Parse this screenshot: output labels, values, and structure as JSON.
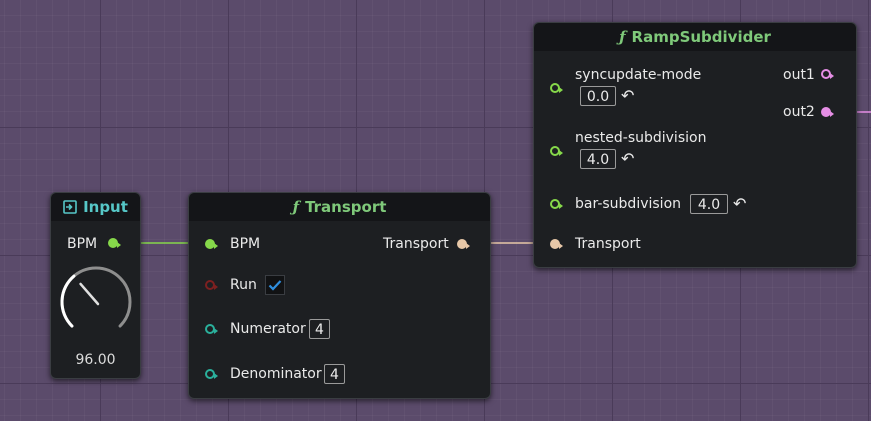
{
  "colors": {
    "background": "#5b4b6b",
    "node": "#1d1f22",
    "pin_float": "#86d84a",
    "pin_bool": "#7d2020",
    "pin_int": "#2ab09c",
    "pin_transport": "#e8c8a8",
    "pin_signal": "#e58ee5",
    "title_function": "#7fc97a",
    "title_input": "#56c7c7"
  },
  "input_node": {
    "title": "Input",
    "icon": "input-arrow-icon",
    "output_label": "BPM",
    "knob_value": "96.00",
    "knob_level": 0.35
  },
  "transport_node": {
    "title": "Transport",
    "icon": "function-icon",
    "func_glyph": "ƒ",
    "inputs": {
      "bpm": "BPM",
      "run": "Run",
      "numerator": "Numerator",
      "denominator": "Denominator"
    },
    "run_checked": true,
    "numerator_value": "4",
    "denominator_value": "4",
    "output_label": "Transport"
  },
  "ramp_node": {
    "title": "RampSubdivider",
    "icon": "function-icon",
    "func_glyph": "ƒ",
    "inputs": {
      "syncupdate": "syncupdate-mode",
      "nested": "nested-subdivision",
      "bar": "bar-subdivision",
      "transport": "Transport"
    },
    "syncupdate_value": "0.0",
    "nested_value": "4.0",
    "bar_value": "4.0",
    "reset_glyph": "↶",
    "outputs": {
      "out1": "out1",
      "out2": "out2"
    }
  }
}
